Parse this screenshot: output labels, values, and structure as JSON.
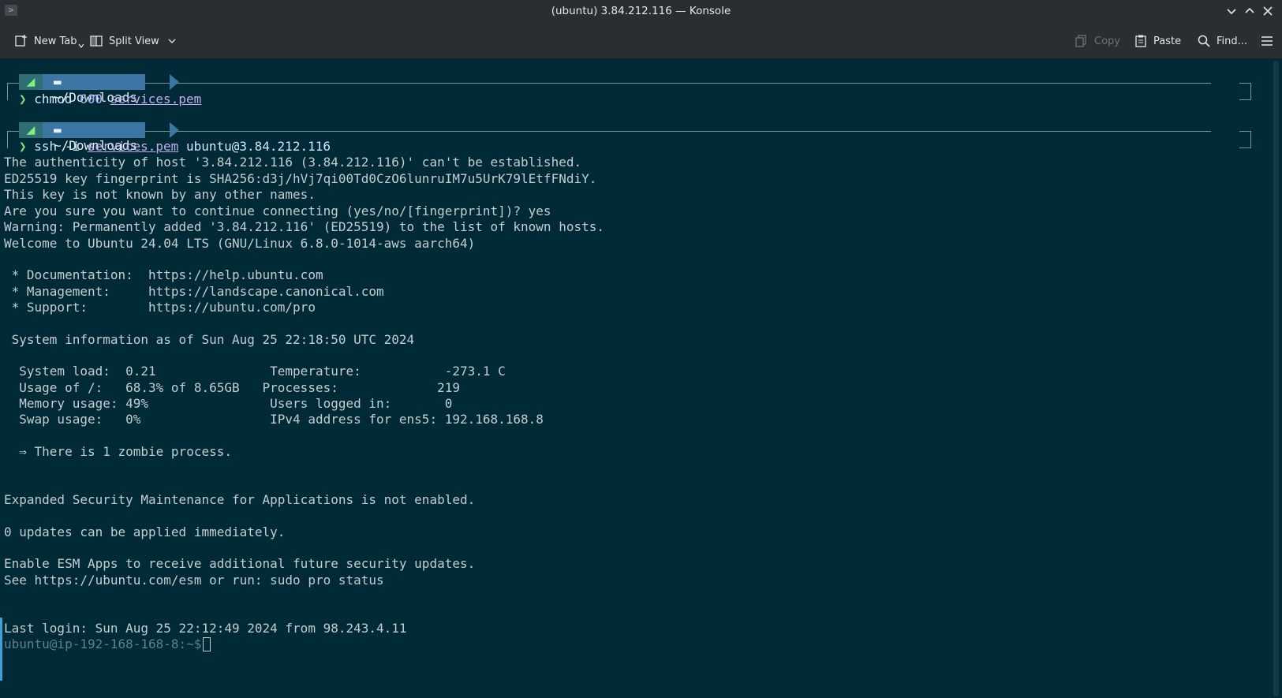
{
  "window": {
    "title": "(ubuntu) 3.84.212.116 — Konsole",
    "app_icon_glyph": ">"
  },
  "toolbar": {
    "new_tab": "New Tab",
    "split_view": "Split View",
    "copy": "Copy",
    "paste": "Paste",
    "find": "Find..."
  },
  "prompt1": {
    "path": "~/Downloads",
    "cmd": "chmod",
    "arg_mode": "600",
    "arg_file": "services.pem"
  },
  "prompt2": {
    "path": "~/Downloads",
    "cmd": "ssh",
    "flag": "-i",
    "arg_file": "services.pem",
    "host": "ubuntu@3.84.212.116"
  },
  "output": [
    "The authenticity of host '3.84.212.116 (3.84.212.116)' can't be established.",
    "ED25519 key fingerprint is SHA256:d3j/hVj7qi00Td0CzO6lunruIM7u5UrK79lEtfFNdiY.",
    "This key is not known by any other names.",
    "Are you sure you want to continue connecting (yes/no/[fingerprint])? yes",
    "Warning: Permanently added '3.84.212.116' (ED25519) to the list of known hosts.",
    "Welcome to Ubuntu 24.04 LTS (GNU/Linux 6.8.0-1014-aws aarch64)",
    "",
    " * Documentation:  https://help.ubuntu.com",
    " * Management:     https://landscape.canonical.com",
    " * Support:        https://ubuntu.com/pro",
    "",
    " System information as of Sun Aug 25 22:18:50 UTC 2024",
    "",
    "  System load:  0.21               Temperature:           -273.1 C",
    "  Usage of /:   68.3% of 8.65GB   Processes:             219",
    "  Memory usage: 49%                Users logged in:       0",
    "  Swap usage:   0%                 IPv4 address for ens5: 192.168.168.8",
    "",
    "  ⇒ There is 1 zombie process.",
    "",
    "",
    "Expanded Security Maintenance for Applications is not enabled.",
    "",
    "0 updates can be applied immediately.",
    "",
    "Enable ESM Apps to receive additional future security updates.",
    "See https://ubuntu.com/esm or run: sudo pro status",
    "",
    "",
    "Last login: Sun Aug 25 22:12:49 2024 from 98.243.4.11"
  ],
  "final_prompt": "ubuntu@ip-192-168-168-8:~$"
}
